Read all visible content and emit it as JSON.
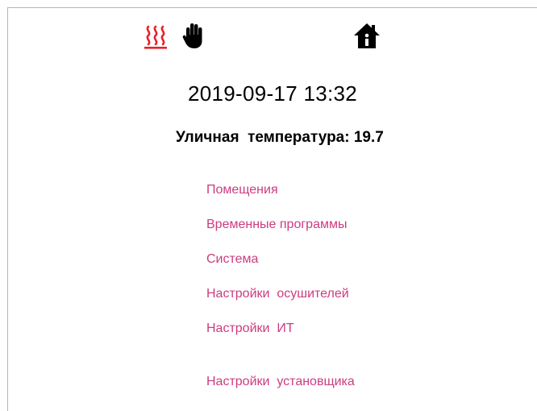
{
  "status_icons": {
    "heating": "heating-icon",
    "manual": "manual-mode-hand-icon",
    "home": "home-info-icon"
  },
  "colors": {
    "heating": "#e8202a",
    "menu_link": "#cc3c80",
    "text": "#000000"
  },
  "datetime": "2019-09-17 13:32",
  "outdoor": {
    "label": "Уличная  температура:",
    "value": "19.7"
  },
  "menu": {
    "items": [
      {
        "label": "Помещения"
      },
      {
        "label": "Временные программы"
      },
      {
        "label": "Система"
      },
      {
        "label": "Настройки  осушителей"
      },
      {
        "label": "Настройки  ИТ"
      },
      {
        "label": "Настройки  установщика"
      }
    ]
  }
}
